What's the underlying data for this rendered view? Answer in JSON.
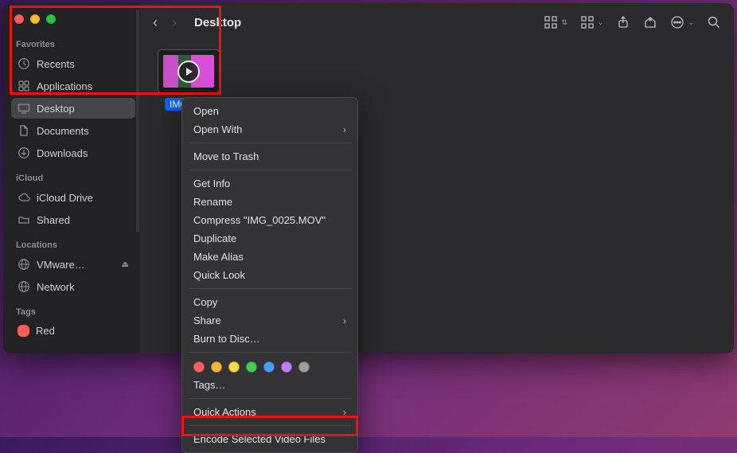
{
  "window_title": "Desktop",
  "sidebar": {
    "favorites_label": "Favorites",
    "items": [
      {
        "label": "Recents",
        "icon": "clock-icon"
      },
      {
        "label": "Applications",
        "icon": "apps-icon"
      },
      {
        "label": "Desktop",
        "icon": "desktop-icon",
        "active": true
      },
      {
        "label": "Documents",
        "icon": "documents-icon"
      },
      {
        "label": "Downloads",
        "icon": "downloads-icon"
      }
    ],
    "icloud_label": "iCloud",
    "icloud_items": [
      {
        "label": "iCloud Drive",
        "icon": "cloud-icon"
      },
      {
        "label": "Shared",
        "icon": "shared-folder-icon"
      }
    ],
    "locations_label": "Locations",
    "locations_items": [
      {
        "label": "VMware…",
        "icon": "globe-icon",
        "eject": true
      },
      {
        "label": "Network",
        "icon": "globe-icon"
      }
    ],
    "tags_label": "Tags",
    "tags_items": [
      {
        "label": "Red",
        "color": "#ff5f57"
      }
    ]
  },
  "file": {
    "name": "IMG_0025.MOV",
    "display_name": "IMG_0…"
  },
  "context_menu": {
    "open": "Open",
    "open_with": "Open With",
    "move_to_trash": "Move to Trash",
    "get_info": "Get Info",
    "rename": "Rename",
    "compress": "Compress \"IMG_0025.MOV\"",
    "duplicate": "Duplicate",
    "make_alias": "Make Alias",
    "quick_look": "Quick Look",
    "copy": "Copy",
    "share": "Share",
    "burn_to_disc": "Burn to Disc…",
    "tag_colors": [
      "#ff6259",
      "#ffb340",
      "#ffd84c",
      "#3ecf4e",
      "#3ea0ff",
      "#c57cff",
      "#9e9ea2"
    ],
    "tags": "Tags…",
    "quick_actions": "Quick Actions",
    "encode": "Encode Selected Video Files"
  }
}
